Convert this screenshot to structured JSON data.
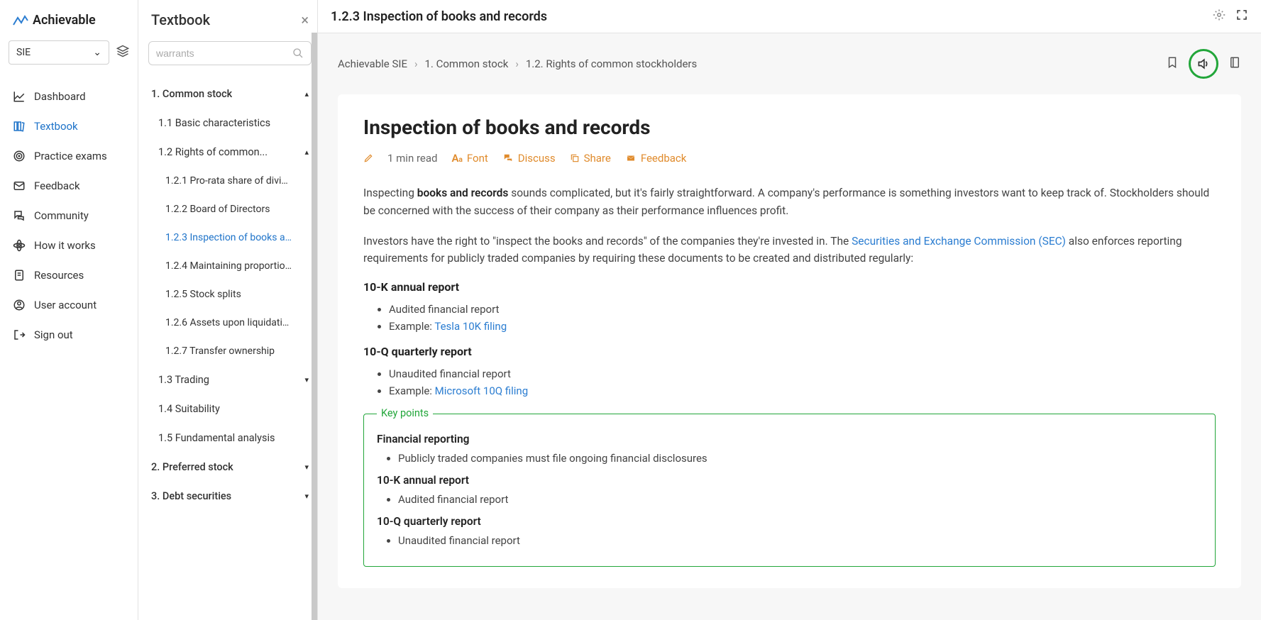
{
  "app": {
    "name": "Achievable"
  },
  "course": {
    "selected": "SIE"
  },
  "nav": {
    "dashboard": "Dashboard",
    "textbook": "Textbook",
    "practice": "Practice exams",
    "feedback": "Feedback",
    "community": "Community",
    "how": "How it works",
    "resources": "Resources",
    "account": "User account",
    "signout": "Sign out"
  },
  "panel": {
    "title": "Textbook",
    "search_placeholder": "warrants"
  },
  "toc": {
    "s1": "1. Common stock",
    "s1_1": "1.1 Basic characteristics",
    "s1_2": "1.2 Rights of common...",
    "s1_2_1": "1.2.1 Pro-rata share of divid...",
    "s1_2_2": "1.2.2 Board of Directors",
    "s1_2_3": "1.2.3 Inspection of books an...",
    "s1_2_4": "1.2.4 Maintaining proportion...",
    "s1_2_5": "1.2.5 Stock splits",
    "s1_2_6": "1.2.6 Assets upon liquidation",
    "s1_2_7": "1.2.7 Transfer ownership",
    "s1_3": "1.3 Trading",
    "s1_4": "1.4 Suitability",
    "s1_5": "1.5 Fundamental analysis",
    "s2": "2. Preferred stock",
    "s3": "3. Debt securities"
  },
  "header": {
    "title": "1.2.3 Inspection of books and records"
  },
  "crumbs": {
    "a": "Achievable SIE",
    "b": "1. Common stock",
    "c": "1.2. Rights of common stockholders"
  },
  "article": {
    "title": "Inspection of books and records",
    "read_time": "1 min read",
    "font": "Font",
    "discuss": "Discuss",
    "share": "Share",
    "feedback": "Feedback",
    "p1a": "Inspecting ",
    "p1b": "books and records",
    "p1c": " sounds complicated, but it's fairly straightforward. A company's performance is something investors want to keep track of. Stockholders should be concerned with the success of their company as their performance influences profit.",
    "p2a": "Investors have the right to \"inspect the books and records\" of the companies they're invested in. The ",
    "p2link": "Securities and Exchange Commission (SEC)",
    "p2b": " also enforces reporting requirements for publicly traded companies by requiring these documents to be created and distributed regularly:",
    "h10k": "10-K annual report",
    "b10k1": "Audited financial report",
    "b10k2a": "Example: ",
    "b10k2link": "Tesla 10K filing",
    "h10q": "10-Q quarterly report",
    "b10q1": "Unaudited financial report",
    "b10q2a": "Example: ",
    "b10q2link": "Microsoft 10Q filing",
    "key_label": "Key points",
    "kp_h1": "Financial reporting",
    "kp_b1": "Publicly traded companies must file ongoing financial disclosures",
    "kp_h2": "10-K annual report",
    "kp_b2": "Audited financial report",
    "kp_h3": "10-Q quarterly report",
    "kp_b3": "Unaudited financial report"
  }
}
